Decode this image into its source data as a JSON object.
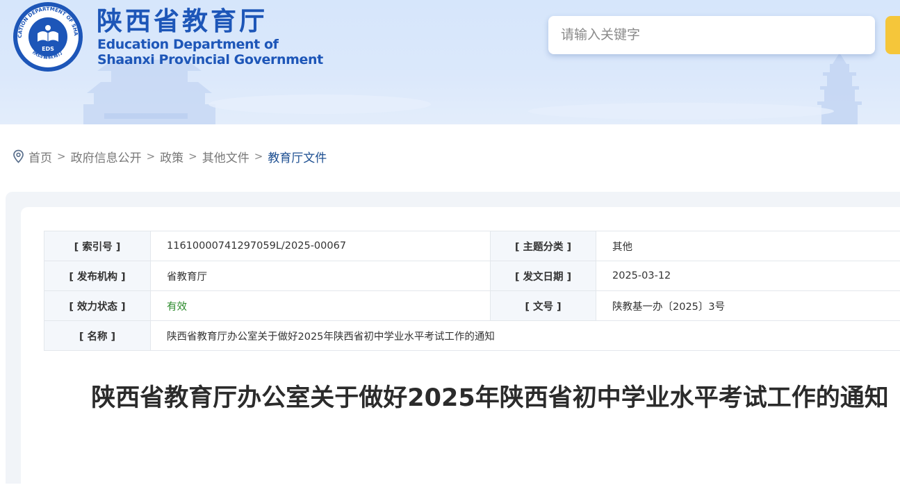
{
  "header": {
    "title_cn": "陕西省教育厅",
    "title_en_line1": "Education Department of",
    "title_en_line2": "Shaanxi Provincial Government",
    "seal_text_top": "EDUCATION DEPARTMENT OF SHAANXI",
    "seal_text_bottom": "陕西省教育厅",
    "seal_center": "EDS",
    "search_placeholder": "请输入关键字",
    "brand_color": "#1d56b8"
  },
  "breadcrumb": {
    "items": [
      "首页",
      "政府信息公开",
      "政策",
      "其他文件"
    ],
    "current": "教育厅文件",
    "separator": ">"
  },
  "meta": {
    "rows": [
      {
        "k1": "[ 索引号 ]",
        "v1": "11610000741297059L/2025-00067",
        "k2": "[ 主题分类 ]",
        "v2": "其他"
      },
      {
        "k1": "[ 发布机构 ]",
        "v1": "省教育厅",
        "k2": "[ 发文日期 ]",
        "v2": "2025-03-12"
      },
      {
        "k1": "[ 效力状态 ]",
        "v1": "有效",
        "k2": "[ 文号 ]",
        "v2": "陕教基一办〔2025〕3号"
      },
      {
        "k1": "[ 名称 ]",
        "v1": "陕西省教育厅办公室关于做好2025年陕西省初中学业水平考试工作的通知"
      }
    ]
  },
  "article": {
    "title": "陕西省教育厅办公室关于做好2025年陕西省初中学业水平考试工作的通知"
  }
}
